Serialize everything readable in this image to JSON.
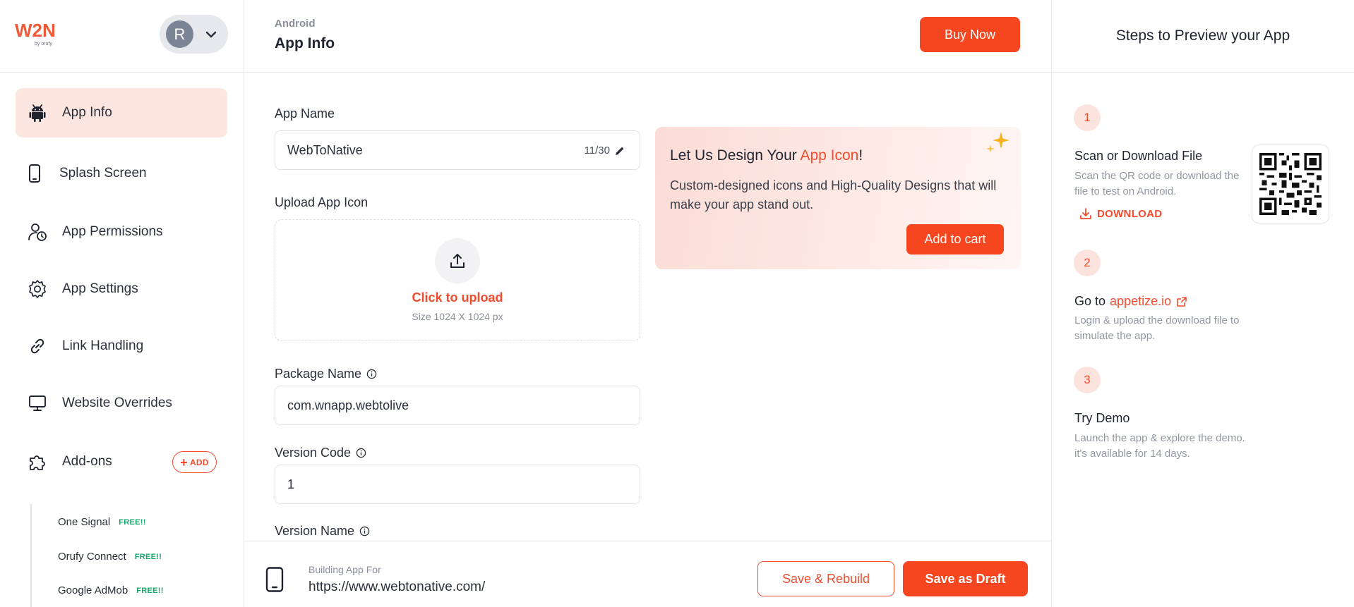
{
  "brand": {
    "logo_text": "W2N",
    "logo_sub": "by orufy",
    "accent": "#f5461f"
  },
  "user": {
    "initial": "R"
  },
  "sidebar": {
    "items": [
      {
        "label": "App Info",
        "icon": "android-icon",
        "active": true
      },
      {
        "label": "Splash Screen",
        "icon": "phone-icon"
      },
      {
        "label": "App Permissions",
        "icon": "user-clock-icon"
      },
      {
        "label": "App Settings",
        "icon": "gear-icon"
      },
      {
        "label": "Link Handling",
        "icon": "link-icon"
      },
      {
        "label": "Website Overrides",
        "icon": "monitor-icon"
      },
      {
        "label": "Add-ons",
        "icon": "puzzle-icon"
      }
    ],
    "add_label": "ADD",
    "addons": [
      {
        "label": "One Signal",
        "badge": "FREE!!"
      },
      {
        "label": "Orufy Connect",
        "badge": "FREE!!"
      },
      {
        "label": "Google AdMob",
        "badge": "FREE!!"
      }
    ]
  },
  "header": {
    "platform": "Android",
    "title": "App Info",
    "buy_label": "Buy Now"
  },
  "form": {
    "app_name_label": "App Name",
    "app_name_value": "WebToNative",
    "app_name_counter": "11/30",
    "upload_label": "Upload App Icon",
    "upload_title": "Click to upload",
    "upload_size": "Size 1024 X 1024 px",
    "package_label": "Package Name",
    "package_value": "com.wnapp.webtolive",
    "version_code_label": "Version Code",
    "version_code_value": "1",
    "version_name_label": "Version Name"
  },
  "promo": {
    "title_prefix": "Let Us Design Your ",
    "title_accent": "App Icon",
    "title_suffix": "!",
    "description": "Custom-designed icons and High-Quality Designs that will make your app stand out.",
    "cart_label": "Add to cart"
  },
  "footer": {
    "building_label": "Building App For",
    "building_url": "https://www.webtonative.com/",
    "rebuild_label": "Save & Rebuild",
    "draft_label": "Save as Draft"
  },
  "preview": {
    "title": "Steps to Preview your App",
    "steps": [
      {
        "num": "1",
        "title": "Scan or Download File",
        "desc": "Scan the QR code or download the file to test on Android.",
        "link": "DOWNLOAD"
      },
      {
        "num": "2",
        "title_prefix": "Go to",
        "title_accent": "appetize.io",
        "desc": "Login & upload the download file to simulate the app."
      },
      {
        "num": "3",
        "title": "Try Demo",
        "desc": "Launch the app & explore the demo. it's available for 14 days."
      }
    ]
  }
}
